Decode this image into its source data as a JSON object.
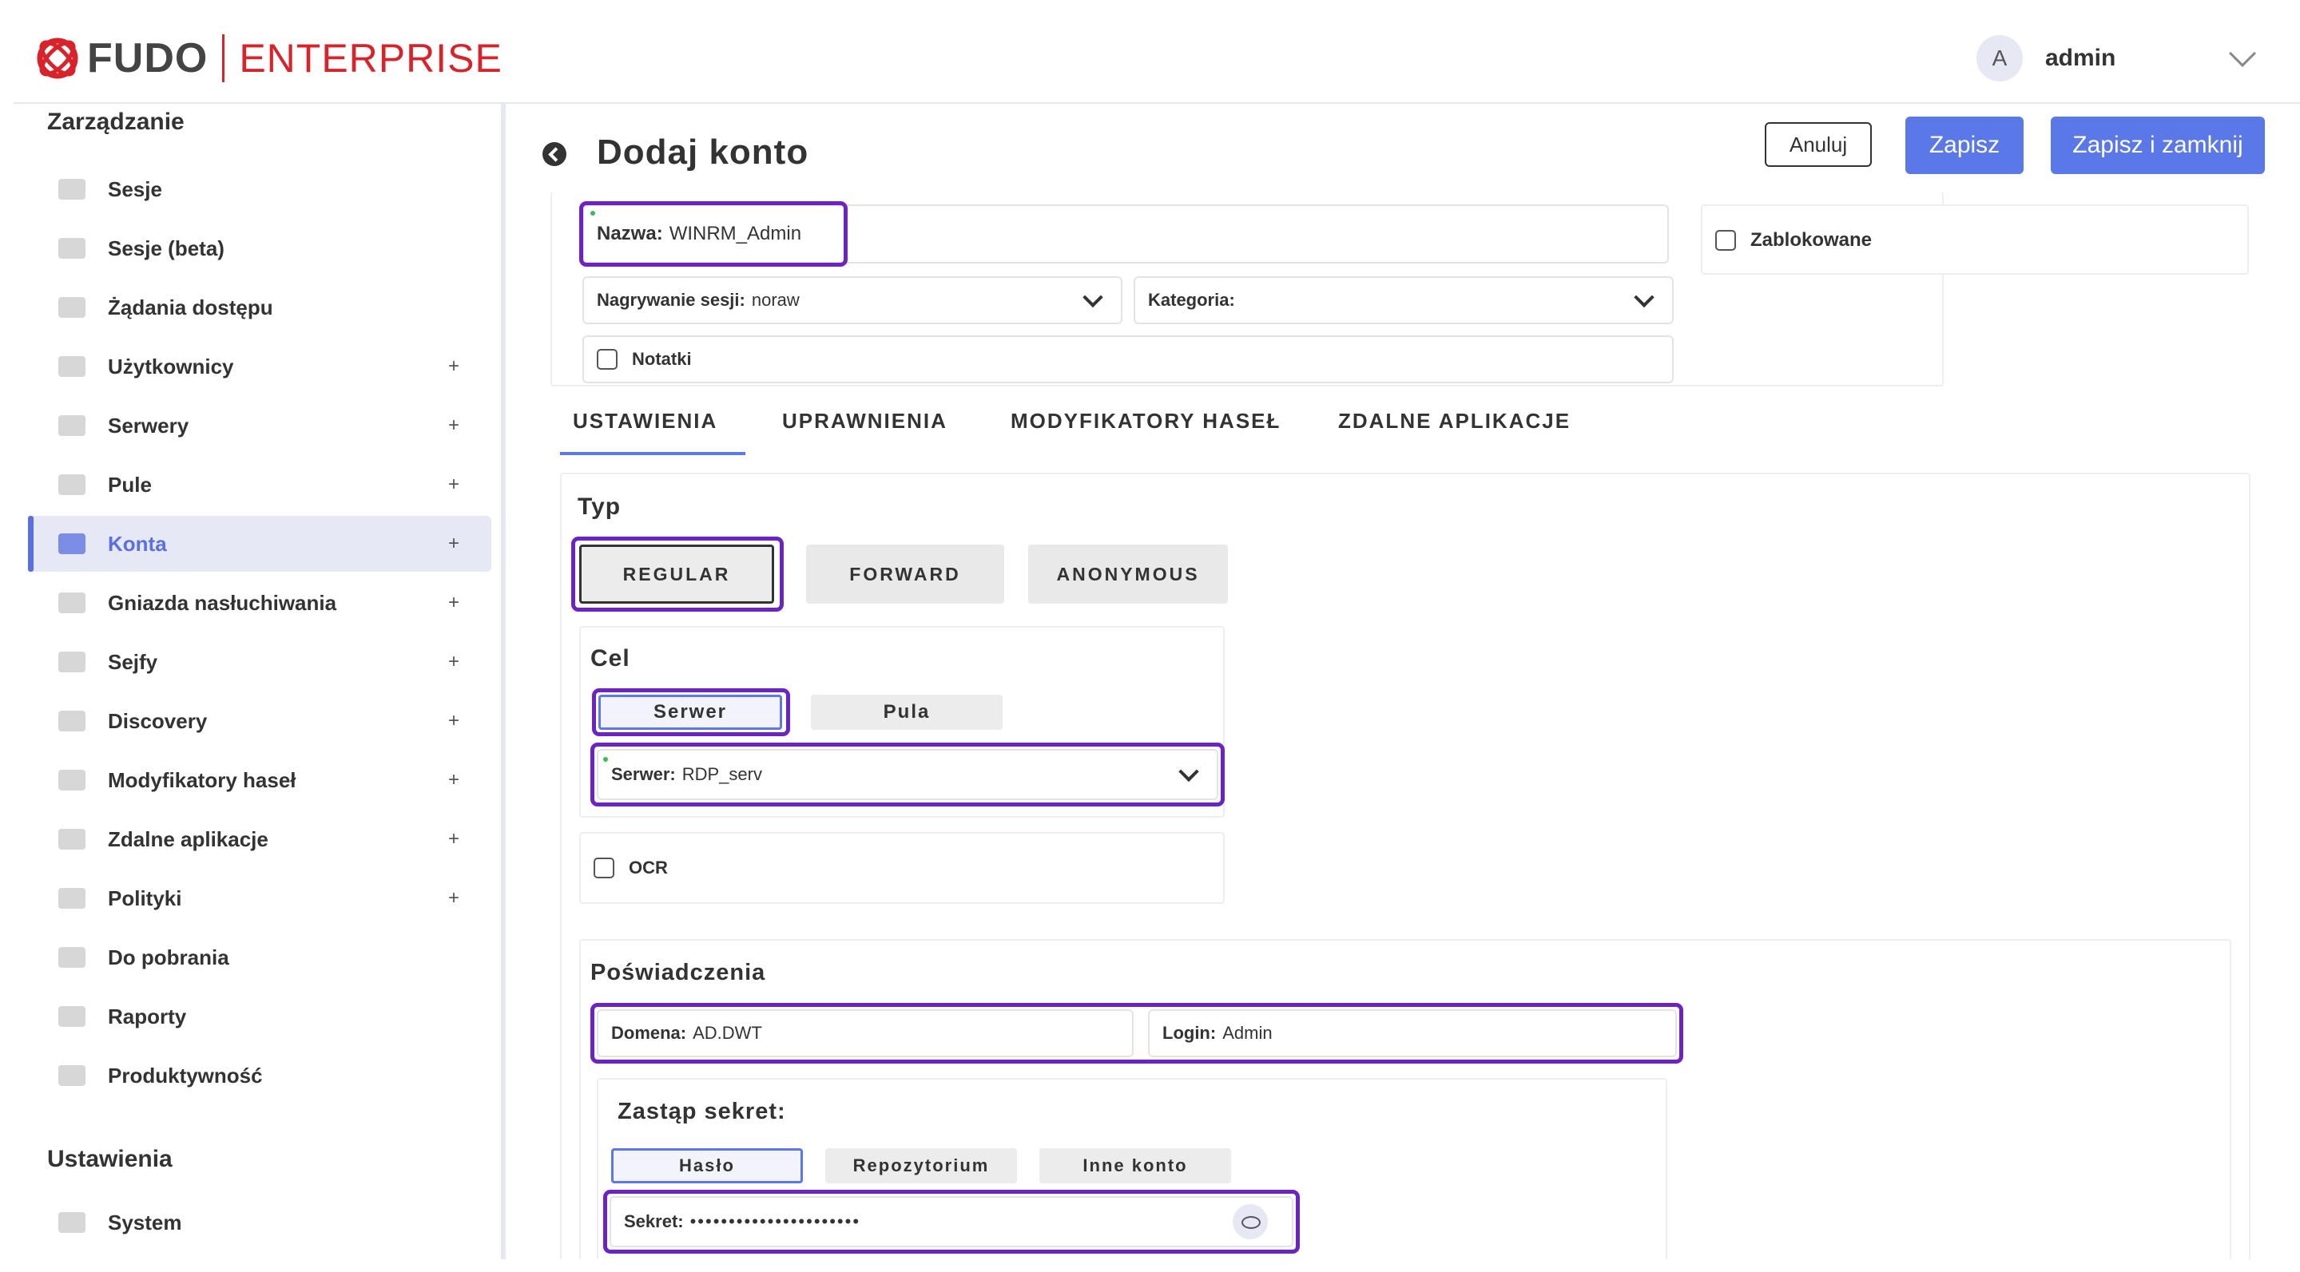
{
  "header": {
    "logo_word": "FUDO",
    "logo_enterprise": "ENTERPRISE",
    "avatar_initial": "A",
    "user_name": "admin"
  },
  "sidebar": {
    "management_title": "Zarządzanie",
    "items": [
      {
        "label": "Sesje",
        "plus": ""
      },
      {
        "label": "Sesje (beta)",
        "plus": ""
      },
      {
        "label": "Żądania dostępu",
        "plus": ""
      },
      {
        "label": "Użytkownicy",
        "plus": "+"
      },
      {
        "label": "Serwery",
        "plus": "+"
      },
      {
        "label": "Pule",
        "plus": "+"
      },
      {
        "label": "Konta",
        "plus": "+"
      },
      {
        "label": "Gniazda nasłuchiwania",
        "plus": "+"
      },
      {
        "label": "Sejfy",
        "plus": "+"
      },
      {
        "label": "Discovery",
        "plus": "+"
      },
      {
        "label": "Modyfikatory haseł",
        "plus": "+"
      },
      {
        "label": "Zdalne aplikacje",
        "plus": "+"
      },
      {
        "label": "Polityki",
        "plus": "+"
      },
      {
        "label": "Do pobrania",
        "plus": ""
      },
      {
        "label": "Raporty",
        "plus": ""
      },
      {
        "label": "Produktywność",
        "plus": ""
      }
    ],
    "settings_title": "Ustawienia",
    "settings_items": [
      {
        "label": "System"
      }
    ]
  },
  "page": {
    "title": "Dodaj konto",
    "cancel_label": "Anuluj",
    "save_label": "Zapisz",
    "save_close_label": "Zapisz i zamknij"
  },
  "form": {
    "name_label": "Nazwa:",
    "name_value": "WINRM_Admin",
    "blocked_label": "Zablokowane",
    "recording_label": "Nagrywanie sesji:",
    "recording_value": "noraw",
    "category_label": "Kategoria:",
    "category_value": "",
    "notes_label": "Notatki"
  },
  "tabs": [
    "USTAWIENIA",
    "UPRAWNIENIA",
    "MODYFIKATORY HASEŁ",
    "ZDALNE APLIKACJE"
  ],
  "settings": {
    "type_title": "Typ",
    "type_options": [
      "REGULAR",
      "FORWARD",
      "ANONYMOUS"
    ],
    "target_title": "Cel",
    "target_options": [
      "Serwer",
      "Pula"
    ],
    "server_label": "Serwer:",
    "server_value": "RDP_serv",
    "ocr_label": "OCR",
    "credentials_title": "Poświadczenia",
    "domain_label": "Domena:",
    "domain_value": "AD.DWT",
    "login_label": "Login:",
    "login_value": "Admin",
    "replace_secret_title": "Zastąp sekret:",
    "secret_options": [
      "Hasło",
      "Repozytorium",
      "Inne konto"
    ],
    "secret_label": "Sekret:",
    "secret_value": "••••••••••••••••••••••"
  },
  "colors": {
    "accent": "#5a78e8",
    "highlight": "#6d22c4",
    "brand_red": "#d8232a"
  }
}
